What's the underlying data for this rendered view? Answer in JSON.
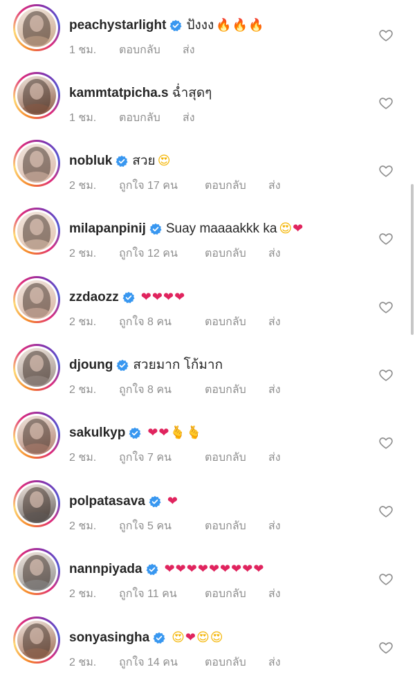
{
  "time_unit": "ชม.",
  "likes_prefix": "ถูกใจ",
  "likes_suffix": "คน",
  "reply_label": "ตอบกลับ",
  "send_label": "ส่ง",
  "colors": {
    "verified_blue": "#3897f0",
    "username_text": "#262626",
    "meta_text": "#8e8e8e",
    "heart_red": "#e0245e",
    "story_ring": "#dd2a7b"
  },
  "comments": [
    {
      "username": "peachystarlight",
      "verified": true,
      "text": "ปังงง",
      "emojis": "🔥🔥🔥",
      "time": "1 ชม.",
      "likes": "",
      "reply": "ตอบกลับ",
      "send": "ส่ง",
      "avatar_color": "#c8a68a"
    },
    {
      "username": "kammtatpicha.s",
      "verified": false,
      "text": "ฉ่ำสุดๆ",
      "emojis": "",
      "time": "1 ชม.",
      "likes": "",
      "reply": "ตอบกลับ",
      "send": "ส่ง",
      "avatar_color": "#8a5a44"
    },
    {
      "username": "nobluk",
      "verified": true,
      "text": "สวย",
      "emojis": "😍",
      "time": "2 ชม.",
      "likes": "ถูกใจ 17 คน",
      "reply": "ตอบกลับ",
      "send": "ส่ง",
      "avatar_color": "#d9b8a8"
    },
    {
      "username": "milapanpinij",
      "verified": true,
      "text": "Suay maaaakkk ka",
      "emojis": "😍❤",
      "time": "2 ชม.",
      "likes": "ถูกใจ 12 คน",
      "reply": "ตอบกลับ",
      "send": "ส่ง",
      "avatar_color": "#e2c4b0"
    },
    {
      "username": "zzdaozz",
      "verified": true,
      "text": "",
      "emojis": "❤❤❤❤",
      "time": "2 ชม.",
      "likes": "ถูกใจ 8 คน",
      "reply": "ตอบกลับ",
      "send": "ส่ง",
      "avatar_color": "#d8b5a4"
    },
    {
      "username": "djoung",
      "verified": true,
      "text": "สวยมาก โก้มาก",
      "emojis": "",
      "time": "2 ชม.",
      "likes": "ถูกใจ 8 คน",
      "reply": "ตอบกลับ",
      "send": "ส่ง",
      "avatar_color": "#9a8e88"
    },
    {
      "username": "sakulkyp",
      "verified": true,
      "text": "",
      "emojis": "❤❤🫰🫰",
      "time": "2 ชม.",
      "likes": "ถูกใจ 7 คน",
      "reply": "ตอบกลับ",
      "send": "ส่ง",
      "avatar_color": "#b08070"
    },
    {
      "username": "polpatasava",
      "verified": true,
      "text": "",
      "emojis": "❤",
      "time": "2 ชม.",
      "likes": "ถูกใจ 5 คน",
      "reply": "ตอบกลับ",
      "send": "ส่ง",
      "avatar_color": "#5e5a58"
    },
    {
      "username": "nannpiyada",
      "verified": true,
      "text": "",
      "emojis": "❤❤❤❤❤❤❤❤❤",
      "time": "2 ชม.",
      "likes": "ถูกใจ 11 คน",
      "reply": "ตอบกลับ",
      "send": "ส่ง",
      "avatar_color": "#8c8c8c"
    },
    {
      "username": "sonyasingha",
      "verified": true,
      "text": "",
      "emojis": "😍❤😍😍",
      "time": "2 ชม.",
      "likes": "ถูกใจ 14 คน",
      "reply": "ตอบกลับ",
      "send": "ส่ง",
      "avatar_color": "#9c6a52"
    }
  ]
}
